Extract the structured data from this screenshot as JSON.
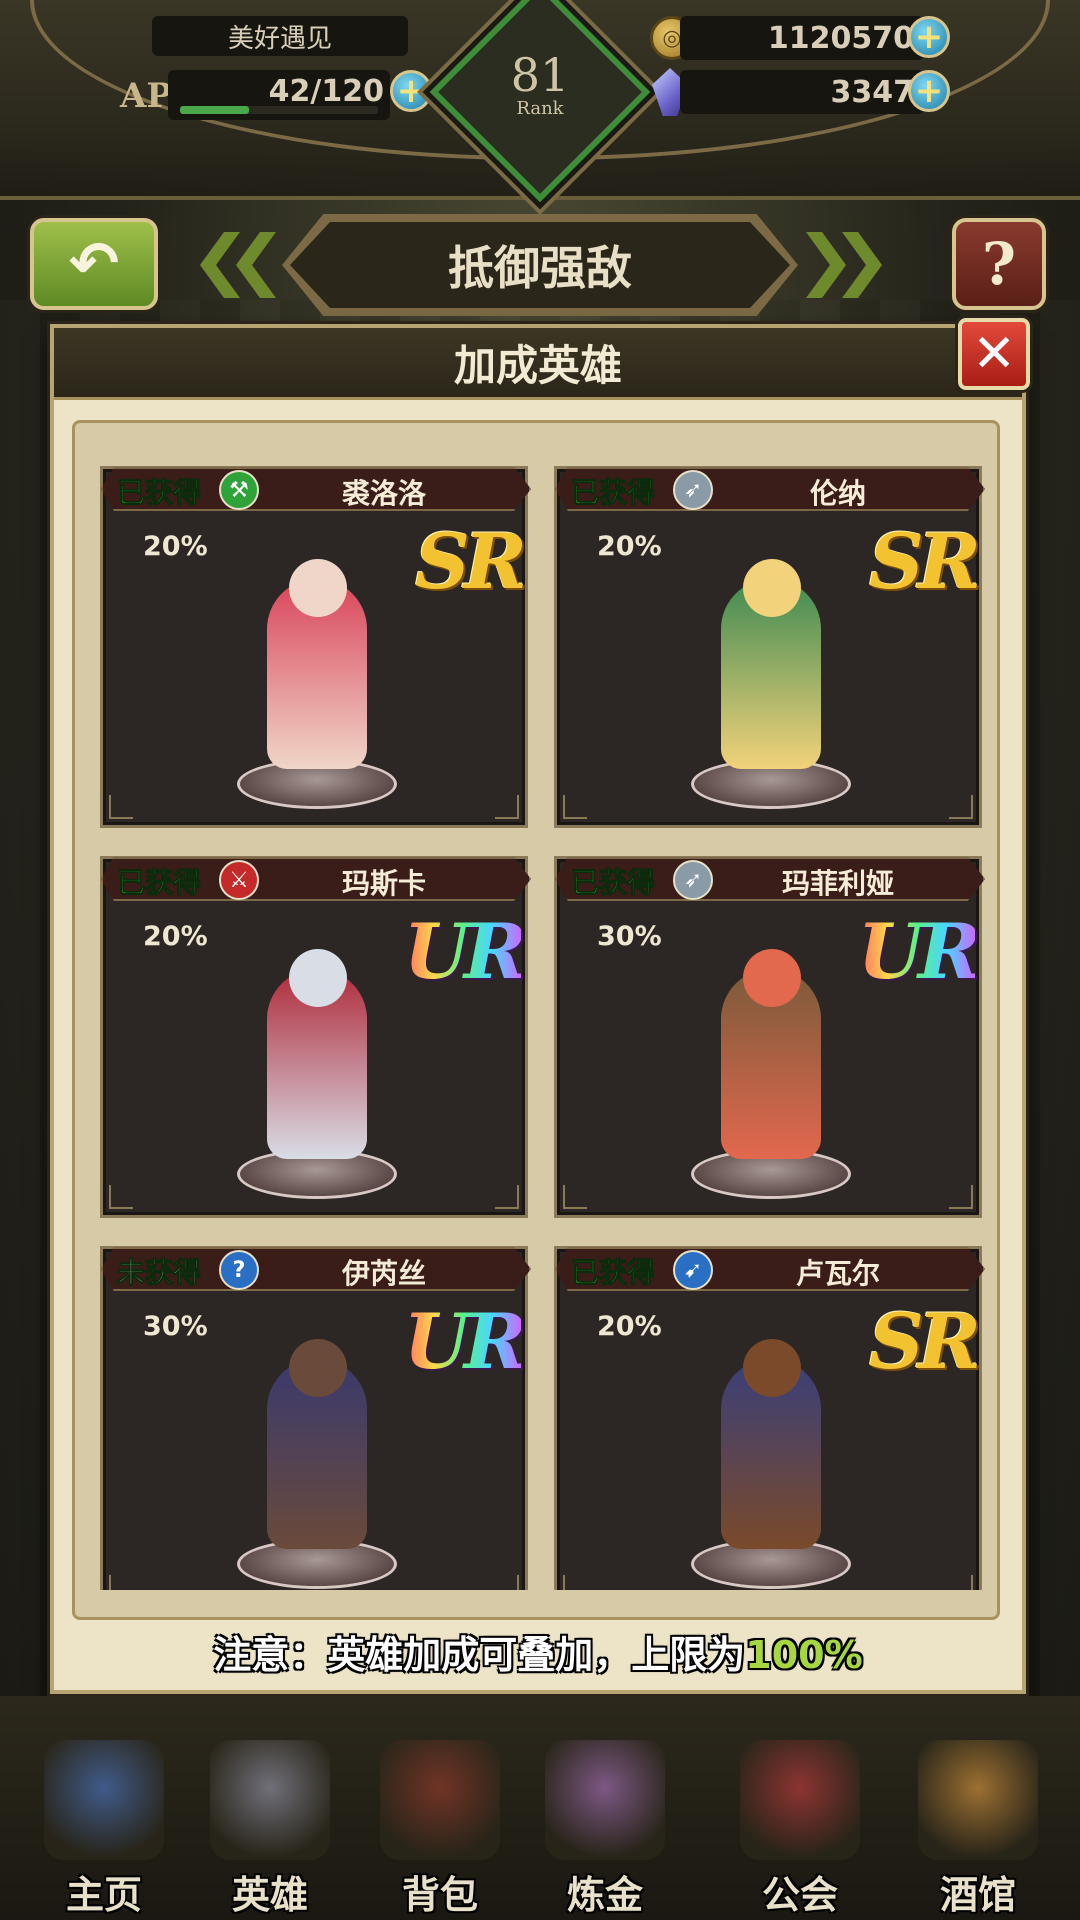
{
  "hud": {
    "player_name": "美好遇见",
    "ap_label": "AP",
    "ap_value": "42/120",
    "ap_fraction": 0.35,
    "rank_number": "81",
    "rank_label": "Rank",
    "gold": "1120570",
    "gems": "3347"
  },
  "page_title": "抵御强敌",
  "dialog": {
    "title": "加成英雄",
    "close_symbol": "✕",
    "note_prefix": "注意：英雄加成可叠加，上限为",
    "note_highlight": "100%"
  },
  "heroes": [
    {
      "status": "已获得",
      "obtained": true,
      "weapon": "axe-icon",
      "weapon_glyph": "⚒",
      "weapon_color": "#2fa33a",
      "name": "裘洛洛",
      "bonus": "20%",
      "rarity": "SR",
      "colors": [
        "#d9445a",
        "#f0d6c8"
      ]
    },
    {
      "status": "已获得",
      "obtained": true,
      "weapon": "bow-icon",
      "weapon_glyph": "➶",
      "weapon_color": "#8a9aa6",
      "name": "伦纳",
      "bonus": "20%",
      "rarity": "SR",
      "colors": [
        "#3f8a52",
        "#f2d27a"
      ]
    },
    {
      "status": "已获得",
      "obtained": true,
      "weapon": "sword-icon",
      "weapon_glyph": "⚔",
      "weapon_color": "#c42a2a",
      "name": "玛斯卡",
      "bonus": "20%",
      "rarity": "UR",
      "colors": [
        "#b02a3a",
        "#d8dde6"
      ]
    },
    {
      "status": "已获得",
      "obtained": true,
      "weapon": "bow-icon",
      "weapon_glyph": "➶",
      "weapon_color": "#8a9aa6",
      "name": "玛菲利娅",
      "bonus": "30%",
      "rarity": "UR",
      "colors": [
        "#7a5a3a",
        "#e2684e"
      ]
    },
    {
      "status": "未获得",
      "obtained": false,
      "weapon": "staff-icon",
      "weapon_glyph": "?",
      "weapon_color": "#2a6fc4",
      "name": "伊芮丝",
      "bonus": "30%",
      "rarity": "UR",
      "colors": [
        "#3a3a6e",
        "#6a4a3a"
      ]
    },
    {
      "status": "已获得",
      "obtained": true,
      "weapon": "spear-icon",
      "weapon_glyph": "➹",
      "weapon_color": "#2a6fc4",
      "name": "卢瓦尔",
      "bonus": "20%",
      "rarity": "SR",
      "colors": [
        "#3a3f7a",
        "#7a4a2a"
      ]
    }
  ],
  "nav": [
    {
      "label": "主页",
      "icon": "castle-icon",
      "color": "#4a6fb0"
    },
    {
      "label": "英雄",
      "icon": "hero-helmet-icon",
      "color": "#8a8a9a"
    },
    {
      "label": "背包",
      "icon": "backpack-icon",
      "color": "#8a3a2a"
    },
    {
      "label": "炼金",
      "icon": "potion-icon",
      "color": "#9a6aa8"
    },
    {
      "label": "公会",
      "icon": "guild-shield-icon",
      "color": "#b03a3a"
    },
    {
      "label": "酒馆",
      "icon": "tavern-mug-icon",
      "color": "#c48a3a"
    }
  ]
}
